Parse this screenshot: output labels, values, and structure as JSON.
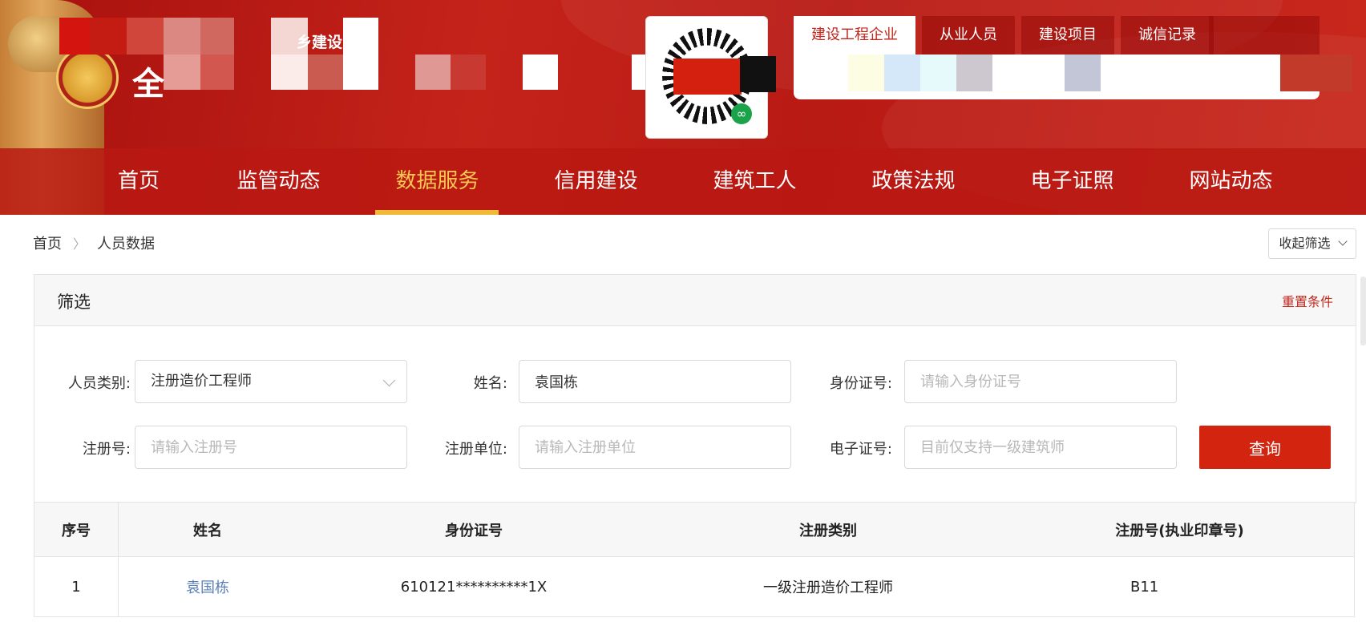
{
  "header": {
    "site_title": "全",
    "site_subtitle": "乡建设",
    "colors": {
      "brand_red": "#c4231a",
      "nav_active": "#f7c752",
      "query_button": "#d3240f",
      "link": "#5a7fb8"
    }
  },
  "search_tabs": [
    {
      "label": "建设工程企业",
      "active": true
    },
    {
      "label": "从业人员",
      "active": false
    },
    {
      "label": "建设项目",
      "active": false
    },
    {
      "label": "诚信记录",
      "active": false
    }
  ],
  "nav": {
    "items": [
      {
        "label": "首页"
      },
      {
        "label": "监管动态"
      },
      {
        "label": "数据服务",
        "active": true
      },
      {
        "label": "信用建设"
      },
      {
        "label": "建筑工人"
      },
      {
        "label": "政策法规"
      },
      {
        "label": "电子证照"
      },
      {
        "label": "网站动态"
      }
    ]
  },
  "breadcrumb": {
    "home": "首页",
    "current": "人员数据"
  },
  "collapse_label": "收起筛选",
  "filter": {
    "title": "筛选",
    "reset_label": "重置条件",
    "person_type": {
      "label": "人员类别:",
      "value": "注册造价工程师"
    },
    "name": {
      "label": "姓名:",
      "value": "袁国栋"
    },
    "id_number": {
      "label": "身份证号:",
      "placeholder": "请输入身份证号"
    },
    "reg_number": {
      "label": "注册号:",
      "placeholder": "请输入注册号"
    },
    "reg_unit": {
      "label": "注册单位:",
      "placeholder": "请输入注册单位"
    },
    "e_cert": {
      "label": "电子证号:",
      "placeholder": "目前仅支持一级建筑师"
    },
    "query_label": "查询"
  },
  "table": {
    "headers": [
      "序号",
      "姓名",
      "身份证号",
      "注册类别",
      "注册号(执业印章号)"
    ],
    "rows": [
      {
        "index": "1",
        "name": "袁国栋",
        "id_number": "610121**********1X",
        "category": "一级注册造价工程师",
        "reg_no": "B11"
      }
    ]
  }
}
